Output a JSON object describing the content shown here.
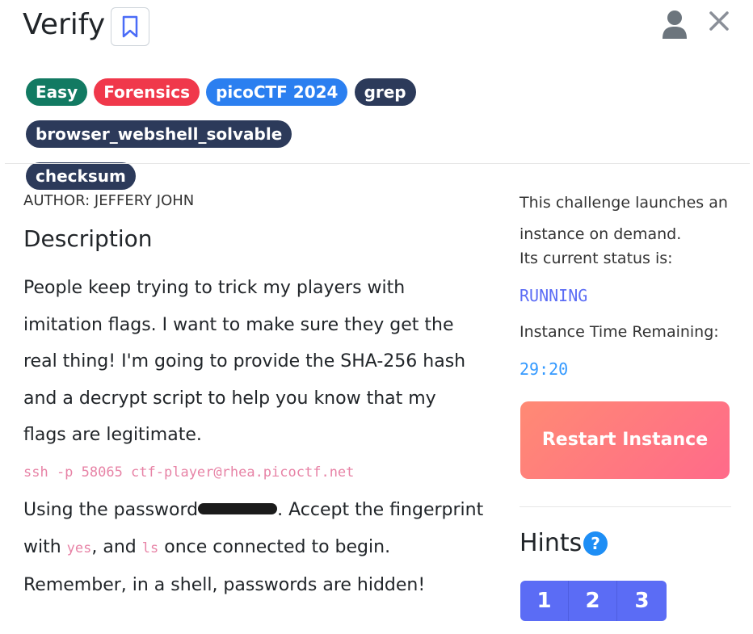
{
  "header": {
    "title": "Verify",
    "icons": {
      "bookmark": "bookmark-icon",
      "user": "user-icon",
      "close": "close-icon"
    }
  },
  "tags": [
    {
      "label": "Easy",
      "color": "#127a62"
    },
    {
      "label": "Forensics",
      "color": "#f0384b"
    },
    {
      "label": "picoCTF 2024",
      "color": "#2b7ff0"
    },
    {
      "label": "grep",
      "color": "#2c3a5a"
    },
    {
      "label": "browser_webshell_solvable",
      "color": "#2c3a5a"
    },
    {
      "label": "checksum",
      "color": "#2c3a5a"
    }
  ],
  "main": {
    "author": "AUTHOR: JEFFERY JOHN",
    "description_heading": "Description",
    "description": "People keep trying to trick my players with imitation flags. I want to make sure they get the real thing! I'm going to provide the SHA-256 hash and a decrypt script to help you know that my flags are legitimate.",
    "command": "ssh -p 58065 ctf-player@rhea.picoctf.net",
    "usage_1": "Using the password",
    "usage_2": ". Accept the fingerprint with ",
    "code_yes": "yes",
    "usage_3": ", and ",
    "code_ls": "ls",
    "usage_4": " once connected to begin. Remember, in a shell, passwords are hidden!"
  },
  "sidebar": {
    "instance_text_1": "This challenge launches an instance on demand.",
    "instance_text_2": "Its current status is:",
    "status": "RUNNING",
    "time_label": "Instance Time Remaining:",
    "time": "29:20",
    "restart_label": "Restart Instance",
    "hints_heading": "Hints",
    "help_glyph": "?",
    "hints": [
      "1",
      "2",
      "3"
    ]
  }
}
